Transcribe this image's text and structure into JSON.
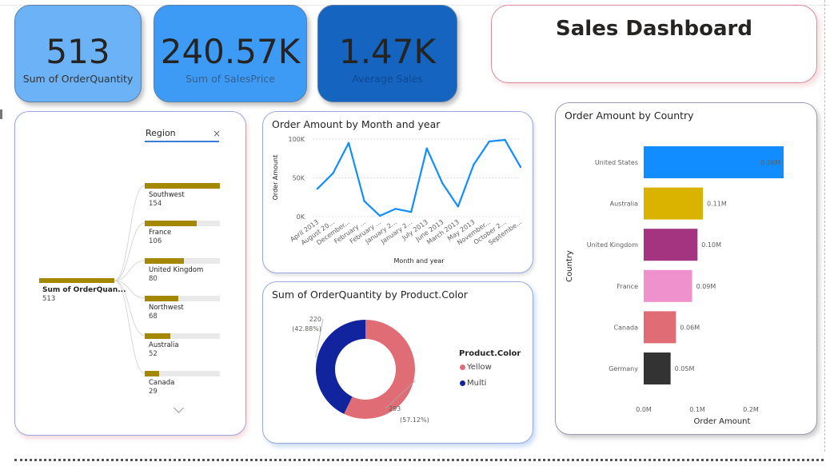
{
  "dashboard_title": "Sales Dashboard",
  "kpis": [
    {
      "value": "513",
      "label": "Sum of OrderQuantity"
    },
    {
      "value": "240.57K",
      "label": "Sum of SalesPrice"
    },
    {
      "value": "1.47K",
      "label": "Average Sales"
    }
  ],
  "decomposition_tree": {
    "filter_label": "Region",
    "close_glyph": "×",
    "root": {
      "name": "Sum of OrderQuan...",
      "value": "513"
    },
    "nodes": [
      {
        "name": "Southwest",
        "value": 154
      },
      {
        "name": "France",
        "value": 106
      },
      {
        "name": "United Kingdom",
        "value": 80
      },
      {
        "name": "Northwest",
        "value": 68
      },
      {
        "name": "Australia",
        "value": 52
      },
      {
        "name": "Canada",
        "value": 29
      }
    ],
    "bar_color": "#a38800",
    "expand_icon": "chevron-down-icon"
  },
  "chart_data": [
    {
      "type": "line",
      "title": "Order Amount by Month and year",
      "xlabel": "Month and year",
      "ylabel": "Order Amount",
      "ylim": [
        0,
        100000
      ],
      "yticks": [
        "0K",
        "50K",
        "100K"
      ],
      "x": [
        "April 2013",
        "August 20...",
        "December...",
        "February ...",
        "February ...",
        "January 2...",
        "January 2...",
        "July 2013",
        "June 2013",
        "March 2013",
        "May 2013",
        "November...",
        "October 2...",
        "Septembe..."
      ],
      "series": [
        {
          "values": [
            36000,
            56000,
            95000,
            20000,
            1000,
            10000,
            6000,
            88000,
            43000,
            13000,
            67000,
            97000,
            99000,
            64000
          ]
        }
      ],
      "color": "#118dff",
      "grid": true
    },
    {
      "type": "pie",
      "title": "Sum of OrderQuantity by Product.Color",
      "legend_title": "Product.Color",
      "categories": [
        "Yellow",
        "Multi"
      ],
      "values": [
        293,
        220
      ],
      "percent_labels": [
        "(57.12%)",
        "(42.88%)"
      ],
      "colors": [
        "#e06c75",
        "#12239e"
      ],
      "donut": true
    },
    {
      "type": "bar",
      "orientation": "horizontal",
      "title": "Order Amount by Country",
      "xlabel": "Order Amount",
      "ylabel": "Country",
      "categories": [
        "United States",
        "Australia",
        "United Kingdom",
        "France",
        "Canada",
        "Germany"
      ],
      "values": [
        0.26,
        0.11,
        0.1,
        0.09,
        0.06,
        0.05
      ],
      "value_labels": [
        "0.26M",
        "0.11M",
        "0.10M",
        "0.09M",
        "0.06M",
        "0.05M"
      ],
      "colors": [
        "#118dff",
        "#d9b300",
        "#a53480",
        "#ee91cc",
        "#e06c75",
        "#333333"
      ],
      "xticks": [
        "0.0M",
        "0.1M",
        "0.2M"
      ],
      "xlim": [
        0,
        0.26
      ]
    }
  ]
}
